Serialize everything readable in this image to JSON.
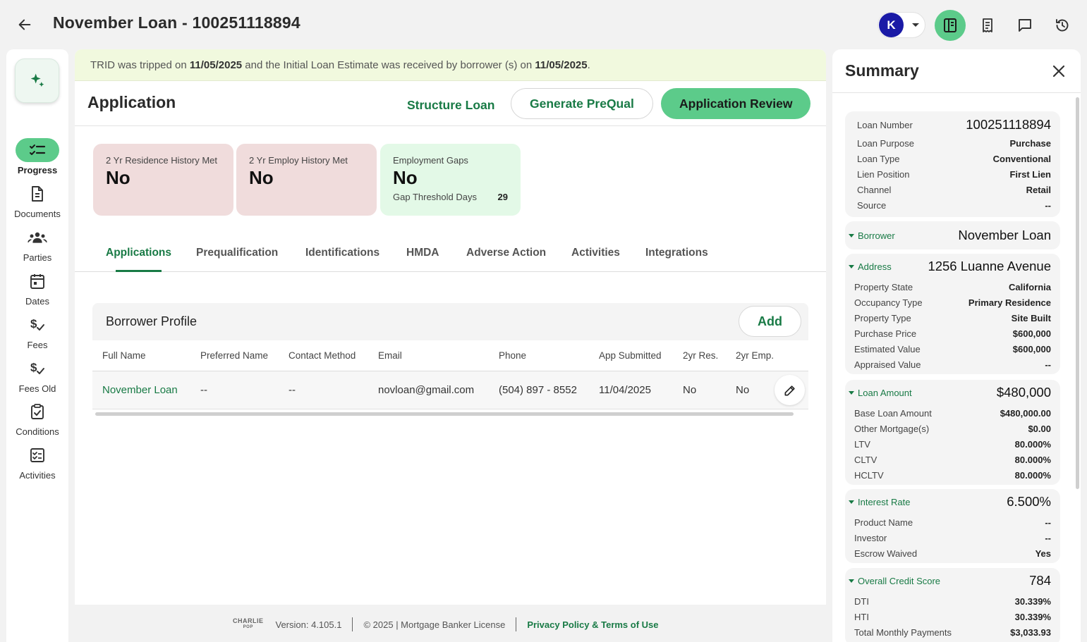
{
  "header": {
    "title": "November Loan - 100251118894",
    "user_initial": "K"
  },
  "nav": {
    "items": [
      {
        "label": "Progress"
      },
      {
        "label": "Documents"
      },
      {
        "label": "Parties"
      },
      {
        "label": "Dates"
      },
      {
        "label": "Fees"
      },
      {
        "label": "Fees Old"
      },
      {
        "label": "Conditions"
      },
      {
        "label": "Activities"
      }
    ]
  },
  "banner": {
    "p1": "TRID was tripped on ",
    "d1": "11/05/2025",
    "p2": " and the Initial Loan Estimate was received by borrower (s) on ",
    "d2": "11/05/2025",
    "p3": "."
  },
  "app": {
    "title": "Application",
    "structure_label": "Structure Loan",
    "prequal_label": "Generate PreQual",
    "review_label": "Application Review"
  },
  "cards": {
    "residence": {
      "label": "2 Yr Residence History Met",
      "value": "No"
    },
    "employ": {
      "label": "2 Yr Employ History Met",
      "value": "No"
    },
    "gaps": {
      "label": "Employment Gaps",
      "value": "No",
      "sub_label": "Gap Threshold Days",
      "sub_value": "29"
    }
  },
  "tabs": [
    "Applications",
    "Prequalification",
    "Identifications",
    "HMDA",
    "Adverse Action",
    "Activities",
    "Integrations"
  ],
  "borrower_profile": {
    "title": "Borrower Profile",
    "add_label": "Add",
    "columns": [
      "Full Name",
      "Preferred Name",
      "Contact Method",
      "Email",
      "Phone",
      "App Submitted",
      "2yr Res.",
      "2yr Emp."
    ],
    "rows": [
      {
        "full_name": "November Loan",
        "preferred_name": "--",
        "contact_method": "--",
        "email": "novloan@gmail.com",
        "phone": "(504) 897 - 8552",
        "app_submitted": "11/04/2025",
        "res": "No",
        "emp": "No"
      }
    ]
  },
  "footer": {
    "logo_text": "CHARLIE",
    "logo_sub": "POP",
    "version": "Version: 4.105.1",
    "copyright": "© 2025 | Mortgage Banker License",
    "privacy": "Privacy Policy & Terms of Use"
  },
  "summary": {
    "title": "Summary",
    "loan": {
      "number_label": "Loan Number",
      "number": "100251118894",
      "rows": [
        {
          "label": "Loan Purpose",
          "value": "Purchase"
        },
        {
          "label": "Loan Type",
          "value": "Conventional"
        },
        {
          "label": "Lien Position",
          "value": "First Lien"
        },
        {
          "label": "Channel",
          "value": "Retail"
        },
        {
          "label": "Source",
          "value": "--"
        }
      ]
    },
    "borrower": {
      "label": "Borrower",
      "value": "November Loan"
    },
    "address": {
      "label": "Address",
      "value": "1256 Luanne Avenue",
      "rows": [
        {
          "label": "Property State",
          "value": "California"
        },
        {
          "label": "Occupancy Type",
          "value": "Primary Residence"
        },
        {
          "label": "Property Type",
          "value": "Site Built"
        },
        {
          "label": "Purchase Price",
          "value": "$600,000"
        },
        {
          "label": "Estimated Value",
          "value": "$600,000"
        },
        {
          "label": "Appraised Value",
          "value": "--"
        }
      ]
    },
    "loan_amount": {
      "label": "Loan Amount",
      "value": "$480,000",
      "rows": [
        {
          "label": "Base Loan Amount",
          "value": "$480,000.00"
        },
        {
          "label": "Other Mortgage(s)",
          "value": "$0.00"
        },
        {
          "label": "LTV",
          "value": "80.000%"
        },
        {
          "label": "CLTV",
          "value": "80.000%"
        },
        {
          "label": "HCLTV",
          "value": "80.000%"
        }
      ]
    },
    "interest": {
      "label": "Interest Rate",
      "value": "6.500%",
      "rows": [
        {
          "label": "Product Name",
          "value": "--"
        },
        {
          "label": "Investor",
          "value": "--"
        },
        {
          "label": "Escrow Waived",
          "value": "Yes"
        }
      ]
    },
    "credit": {
      "label": "Overall Credit Score",
      "value": "784",
      "rows": [
        {
          "label": "DTI",
          "value": "30.339%"
        },
        {
          "label": "HTI",
          "value": "30.339%"
        },
        {
          "label": "Total Monthly Payments",
          "value": "$3,033.93"
        }
      ]
    }
  }
}
